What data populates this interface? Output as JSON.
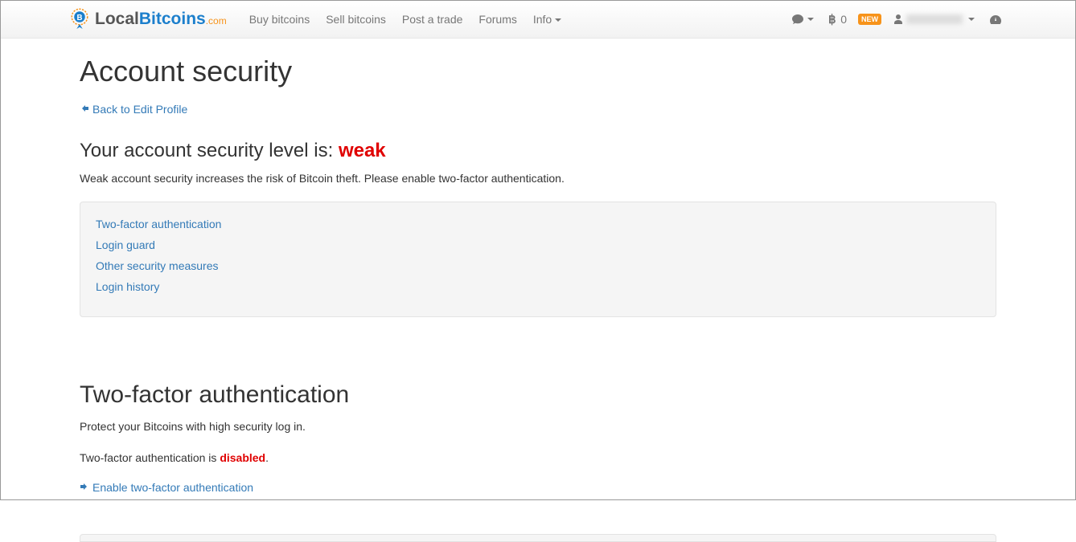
{
  "logo": {
    "local": "Local",
    "bitcoins": "Bitcoins",
    "com": ".com"
  },
  "nav": {
    "buy": "Buy bitcoins",
    "sell": "Sell bitcoins",
    "post": "Post a trade",
    "forums": "Forums",
    "info": "Info"
  },
  "navright": {
    "balance": "0",
    "new_badge": "NEW"
  },
  "page": {
    "title": "Account security",
    "back_link": "Back to Edit Profile",
    "level_prefix": "Your account security level is: ",
    "level_value": "weak",
    "weak_warning": "Weak account security increases the risk of Bitcoin theft. Please enable two-factor authentication."
  },
  "toc": {
    "twofa": "Two-factor authentication",
    "login_guard": "Login guard",
    "other": "Other security measures",
    "history": "Login history"
  },
  "twofa": {
    "heading": "Two-factor authentication",
    "desc": "Protect your Bitcoins with high security log in.",
    "status_prefix": "Two-factor authentication is ",
    "status_value": "disabled",
    "status_suffix": ".",
    "enable_link": "Enable two-factor authentication"
  }
}
